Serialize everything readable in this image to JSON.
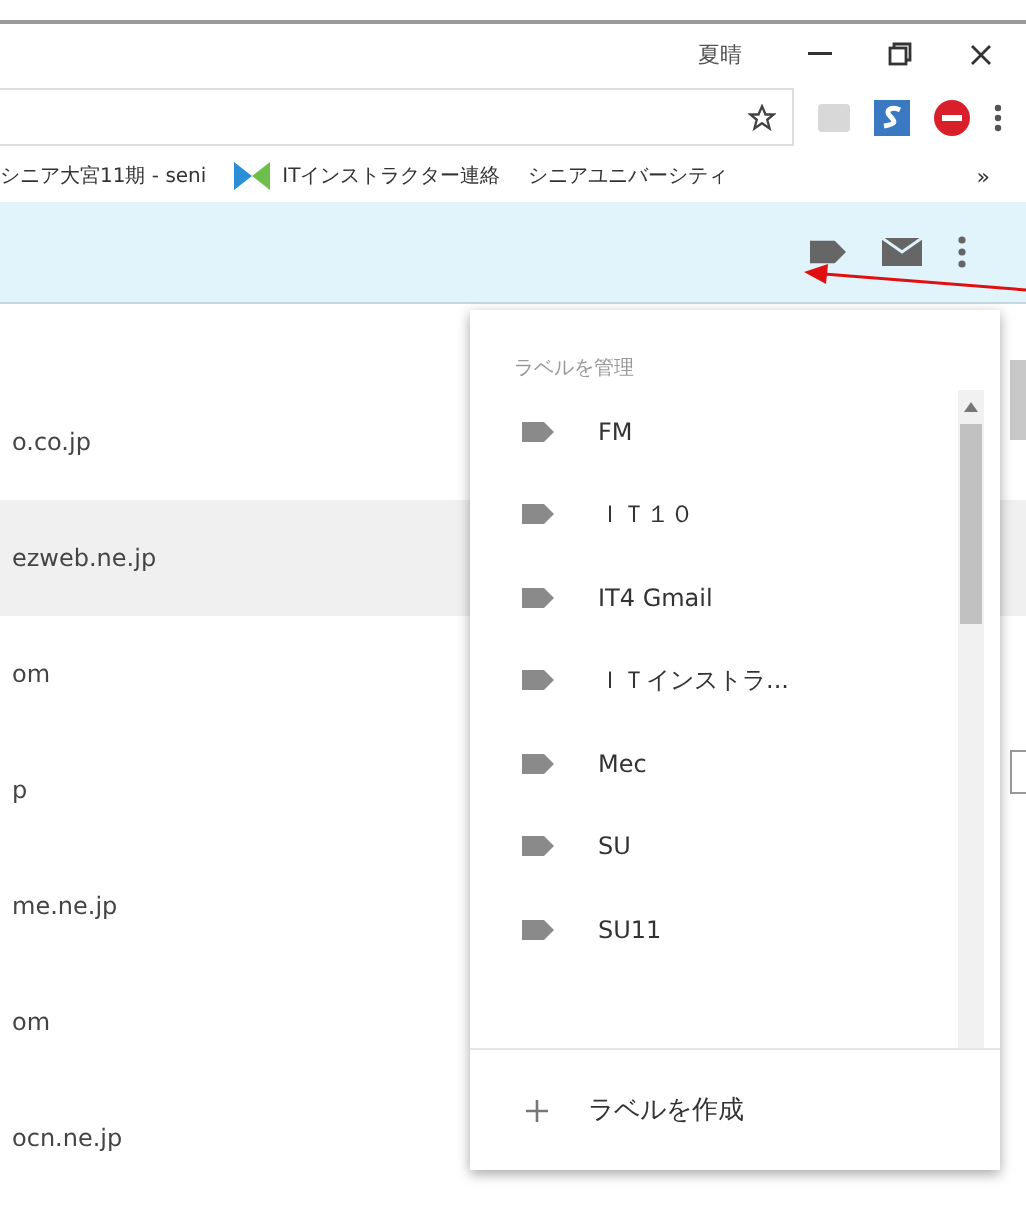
{
  "window": {
    "profile": "夏晴"
  },
  "bookmarks": [
    {
      "label": "シニア大宮11期 - seni",
      "kind": "plain"
    },
    {
      "label": "ITインストラクター連絡",
      "kind": "logo"
    },
    {
      "label": "シニアユニバーシティ",
      "kind": "plain"
    }
  ],
  "bookmarks_more": "»",
  "messages": [
    {
      "sender": "o.co.jp",
      "selected": false
    },
    {
      "sender": "ezweb.ne.jp",
      "selected": true
    },
    {
      "sender": "om",
      "selected": false
    },
    {
      "sender": "p",
      "selected": false
    },
    {
      "sender": "me.ne.jp",
      "selected": false
    },
    {
      "sender": "om",
      "selected": false
    },
    {
      "sender": "ocn.ne.jp",
      "selected": false
    }
  ],
  "label_menu": {
    "title": "ラベルを管理",
    "labels": [
      "FM",
      "ＩＴ１０",
      "IT4 Gmail",
      "ＩＴインストラ...",
      "Mec",
      "SU",
      "SU11"
    ],
    "create": "ラベルを作成"
  }
}
